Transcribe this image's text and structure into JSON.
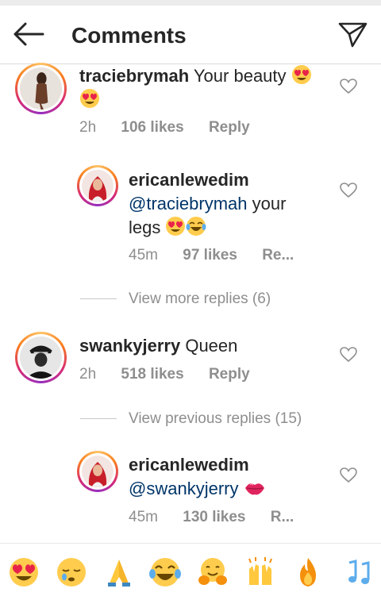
{
  "header": {
    "title": "Comments"
  },
  "comments": [
    {
      "username": "traciebrymah",
      "text": "Your beauty",
      "time": "2h",
      "likes": "106 likes",
      "reply": "Reply"
    },
    {
      "username": "ericanlewedim",
      "mention": "@traciebrymah",
      "text_a": "your",
      "text_b": "legs",
      "time": "45m",
      "likes": "97 likes",
      "reply": "Re..."
    },
    {
      "username": "swankyjerry",
      "text": "Queen",
      "time": "2h",
      "likes": "518 likes",
      "reply": "Reply"
    },
    {
      "username": "ericanlewedim",
      "mention": "@swankyjerry",
      "time": "45m",
      "likes": "130 likes",
      "reply": "R..."
    }
  ],
  "thread_links": {
    "view_more": "View more replies (6)",
    "view_previous": "View previous replies (15)"
  },
  "emoji_bar": {
    "items": [
      "heart-eyes",
      "sleepy",
      "praying-hands",
      "tears-of-joy",
      "hugging",
      "raising-hands",
      "fire",
      "music-notes"
    ]
  },
  "colors": {
    "mention": "#003569",
    "meta": "#8e8e8e"
  }
}
